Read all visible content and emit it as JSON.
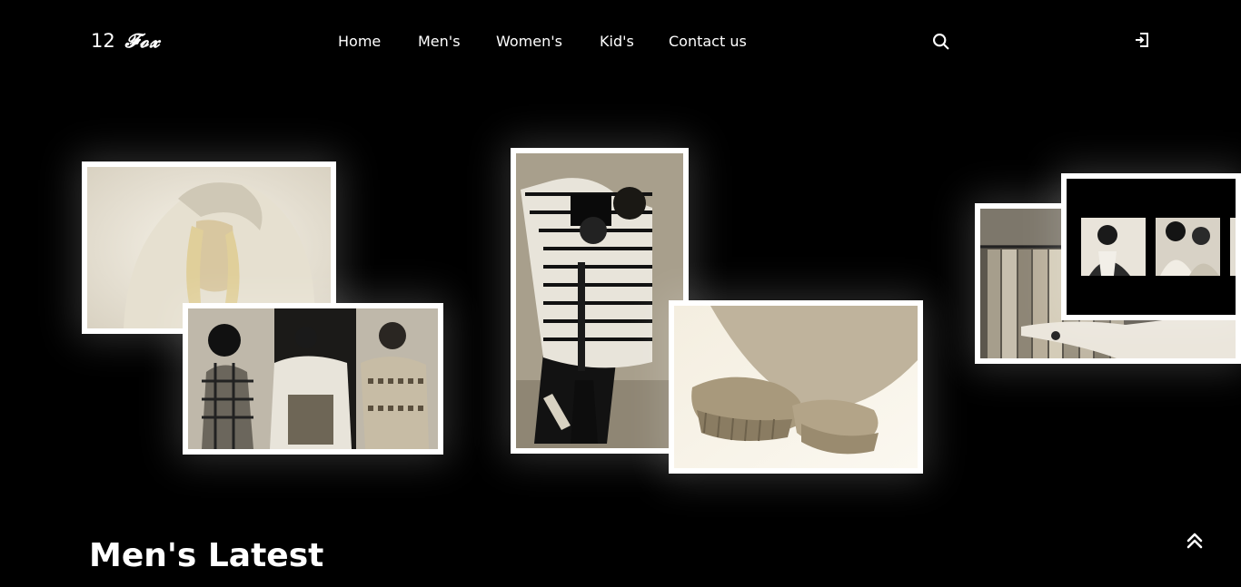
{
  "brand": {
    "number": "12",
    "name": "𝓕𝓸𝔁"
  },
  "nav": {
    "items": [
      {
        "label": "Home"
      },
      {
        "label": "Men's"
      },
      {
        "label": "Women's"
      },
      {
        "label": "Kid's"
      },
      {
        "label": "Contact us"
      }
    ]
  },
  "icons": {
    "search": "search-icon",
    "logout": "logout-icon",
    "scroll_top": "double-chevron-up-icon"
  },
  "gallery": {
    "photos": [
      {
        "name": "woman-hoodie-photo"
      },
      {
        "name": "group-streetwear-photo"
      },
      {
        "name": "photographer-striped-shirt-photo"
      },
      {
        "name": "sweatshirt-cuffs-photo"
      },
      {
        "name": "clothing-rack-photo"
      },
      {
        "name": "thumbnails-strip-photo"
      }
    ]
  },
  "section": {
    "title": "Men's Latest"
  },
  "colors": {
    "background": "#000000",
    "text": "#ffffff",
    "frame": "#ffffff"
  }
}
